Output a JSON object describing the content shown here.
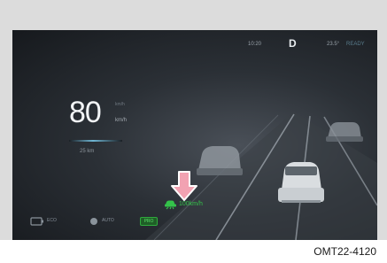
{
  "status": {
    "clock": "10:20",
    "gear": "D",
    "temperature": "23.5°",
    "mode": "READY"
  },
  "speed": {
    "value": "80",
    "unit_top": "km/h",
    "unit": "km/h",
    "trip": "25 km"
  },
  "cruise": {
    "text": "100km/h",
    "icon": "adaptive-cruise-icon"
  },
  "bottom": {
    "item1": "ECO",
    "item2": "AUTO",
    "badge": "PRO"
  },
  "callout": {
    "icon": "pointer-arrow-icon"
  },
  "caption": "OMT22-4120",
  "colors": {
    "accent_green": "#34c24a",
    "arrow_pink": "#f2a2b2",
    "speed_bar_blue": "#6fb6d4"
  }
}
